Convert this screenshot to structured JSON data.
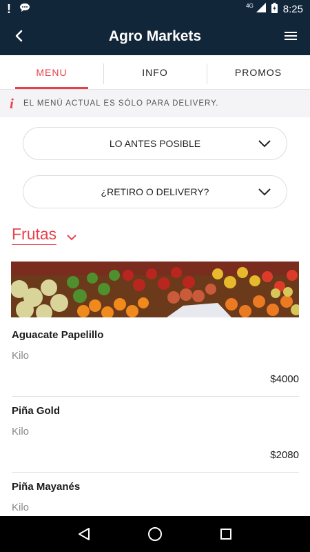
{
  "status_bar": {
    "time": "8:25",
    "network": "4G"
  },
  "app_bar": {
    "title": "Agro Markets"
  },
  "tabs": [
    {
      "label": "MENU",
      "active": true
    },
    {
      "label": "INFO",
      "active": false
    },
    {
      "label": "PROMOS",
      "active": false
    }
  ],
  "notice": {
    "icon": "i",
    "text": "EL MENÚ ACTUAL ES SÓLO PARA DELIVERY."
  },
  "selects": {
    "time": {
      "value": "LO ANTES POSIBLE"
    },
    "mode": {
      "value": "¿RETIRO O DELIVERY?"
    }
  },
  "category": {
    "title": "Frutas"
  },
  "products": [
    {
      "name": "Aguacate Papelillo",
      "unit": "Kilo",
      "price": "$4000"
    },
    {
      "name": "Piña Gold",
      "unit": "Kilo",
      "price": "$2080"
    },
    {
      "name": "Piña Mayanés",
      "unit": "Kilo",
      "price": ""
    }
  ],
  "colors": {
    "header": "#12263a",
    "accent": "#e8414d"
  }
}
